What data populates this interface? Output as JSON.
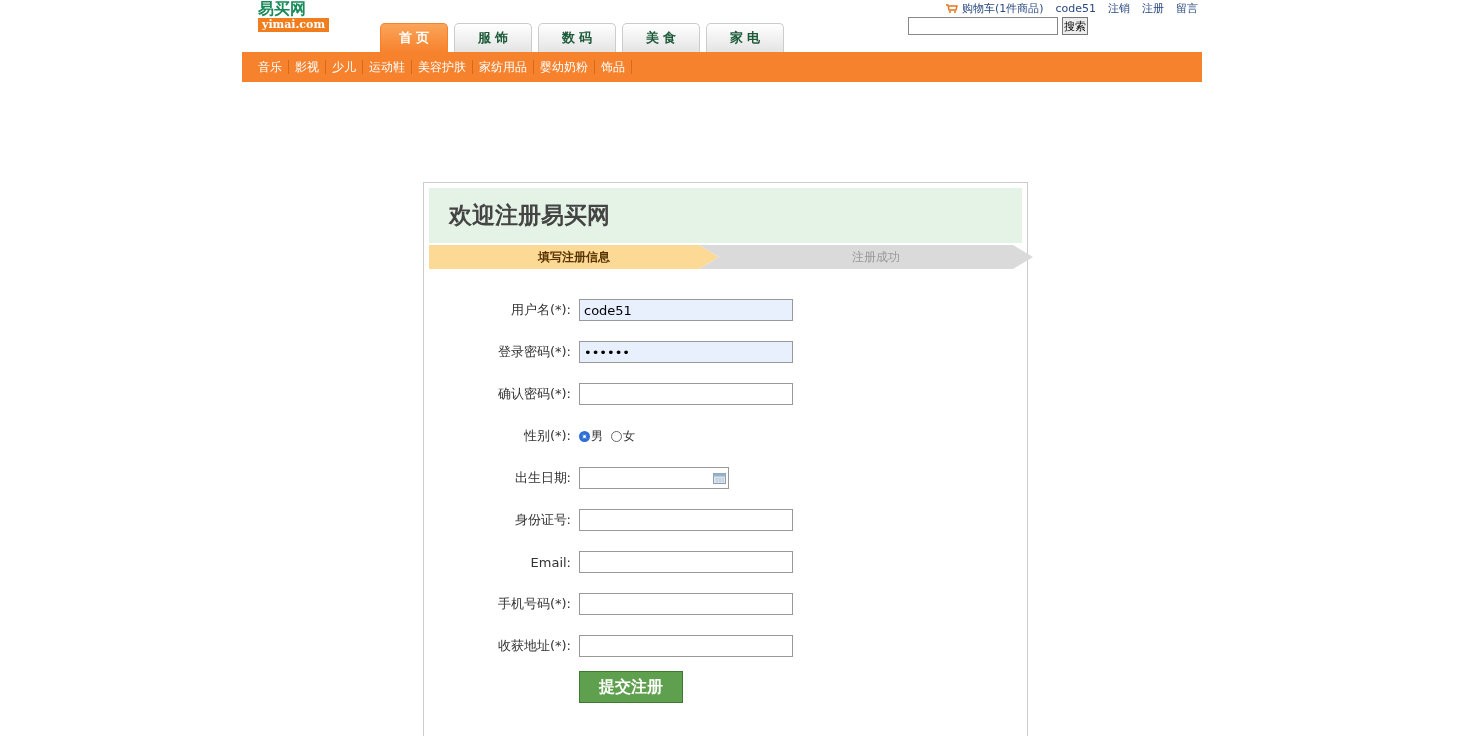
{
  "logo": {
    "name": "易买网",
    "domain": "yimai.com"
  },
  "top_links": [
    {
      "label": "购物车(1件商品)",
      "kind": "cart"
    },
    {
      "label": "code51",
      "kind": "link"
    },
    {
      "label": "注销",
      "kind": "link"
    },
    {
      "label": "注册",
      "kind": "link"
    },
    {
      "label": "留言",
      "kind": "link"
    }
  ],
  "search": {
    "button": "搜索"
  },
  "tabs": [
    {
      "label": "首 页",
      "selected": true
    },
    {
      "label": "服 饰",
      "selected": false
    },
    {
      "label": "数 码",
      "selected": false
    },
    {
      "label": "美 食",
      "selected": false
    },
    {
      "label": "家 电",
      "selected": false
    }
  ],
  "subnav": [
    "音乐",
    "影视",
    "少儿",
    "运动鞋",
    "美容护肤",
    "家纺用品",
    "婴幼奶粉",
    "饰品"
  ],
  "form": {
    "title": "欢迎注册易买网",
    "steps": [
      {
        "label": "填写注册信息",
        "selected": true
      },
      {
        "label": "注册成功",
        "selected": false
      }
    ],
    "fields": [
      {
        "label": "用户名(*):",
        "kind": "text",
        "value": "code51",
        "autofilled": true
      },
      {
        "label": "登录密码(*):",
        "kind": "password",
        "value": "••••••",
        "autofilled": true
      },
      {
        "label": "确认密码(*):",
        "kind": "password",
        "autofilled": false
      },
      {
        "label": "性别(*):",
        "kind": "radio",
        "options": [
          {
            "label": "男",
            "selected": true
          },
          {
            "label": "女",
            "selected": false
          }
        ]
      },
      {
        "label": "出生日期:",
        "kind": "date"
      },
      {
        "label": "身份证号:",
        "kind": "text",
        "autofilled": false
      },
      {
        "label": "Email:",
        "kind": "text",
        "autofilled": false
      },
      {
        "label": "手机号码(*):",
        "kind": "text",
        "autofilled": false
      },
      {
        "label": "收获地址(*):",
        "kind": "text",
        "autofilled": false
      }
    ],
    "submit": "提交注册"
  }
}
